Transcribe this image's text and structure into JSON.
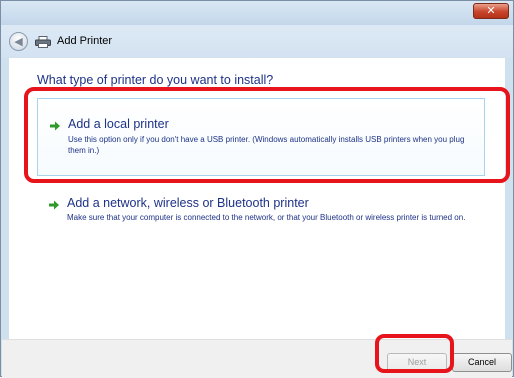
{
  "window": {
    "title": "Add Printer",
    "close_glyph": "✕"
  },
  "nav": {
    "back_glyph": "◀",
    "back_icon": "back-arrow-icon",
    "printer_icon": "printer-icon"
  },
  "content": {
    "question": "What type of printer do you want to install?",
    "options": [
      {
        "title": "Add a local printer",
        "description": "Use this option only if you don't have a USB printer. (Windows automatically installs USB printers when you plug them in.)",
        "icon": "green-arrow-icon",
        "highlighted": true
      },
      {
        "title": "Add a network, wireless or Bluetooth printer",
        "description": "Make sure that your computer is connected to the network, or that your Bluetooth or wireless printer is turned on.",
        "icon": "green-arrow-icon",
        "highlighted": false
      }
    ]
  },
  "footer": {
    "next_label": "Next",
    "next_enabled": false,
    "cancel_label": "Cancel"
  },
  "colors": {
    "link_blue": "#1e3287",
    "arrow_green": "#2f9a2a",
    "annotation_red": "#e8141b",
    "close_red": "#c8442a"
  }
}
